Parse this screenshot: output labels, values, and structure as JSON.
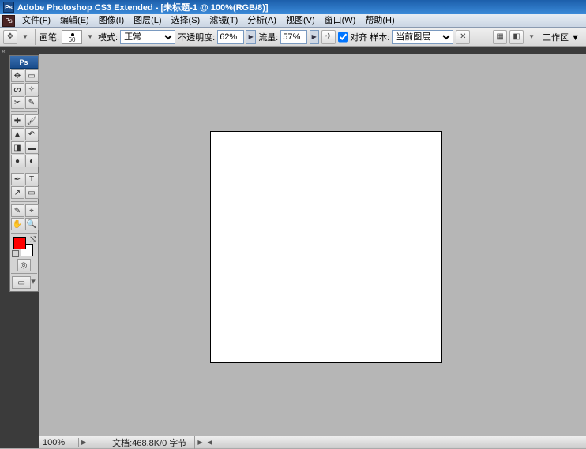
{
  "title": "Adobe Photoshop CS3 Extended - [未标题-1 @ 100%(RGB/8)]",
  "menu": [
    "文件(F)",
    "编辑(E)",
    "图像(I)",
    "图层(L)",
    "选择(S)",
    "滤镜(T)",
    "分析(A)",
    "视图(V)",
    "窗口(W)",
    "帮助(H)"
  ],
  "opt": {
    "brush_label": "画笔:",
    "brush_size": "60",
    "mode_label": "模式:",
    "mode_value": "正常",
    "opacity_label": "不透明度:",
    "opacity_value": "62%",
    "flow_label": "流量:",
    "flow_value": "57%",
    "aligned_label": "对齐",
    "sample_label": "样本:",
    "sample_value": "当前图层",
    "workspace_label": "工作区 ▼"
  },
  "status": {
    "zoom": "100%",
    "doc": "文档:468.8K/0 字节"
  },
  "colors": {
    "fg": "#f00",
    "bg": "#fff"
  },
  "icons": {
    "move": "✥",
    "marquee": "▭",
    "lasso": "ᔕ",
    "wand": "✧",
    "crop": "✂",
    "slice": "✎",
    "heal": "✚",
    "brush": "🖌",
    "stamp": "▲",
    "history": "↶",
    "eraser": "◨",
    "grad": "▬",
    "blur": "●",
    "dodge": "◐",
    "pen": "✒",
    "type": "T",
    "path": "↗",
    "shape": "▭",
    "notes": "✎",
    "eyedrop": "⌖",
    "hand": "✋",
    "zoom": "🔍",
    "qmask": "◎",
    "screen": "▭"
  }
}
